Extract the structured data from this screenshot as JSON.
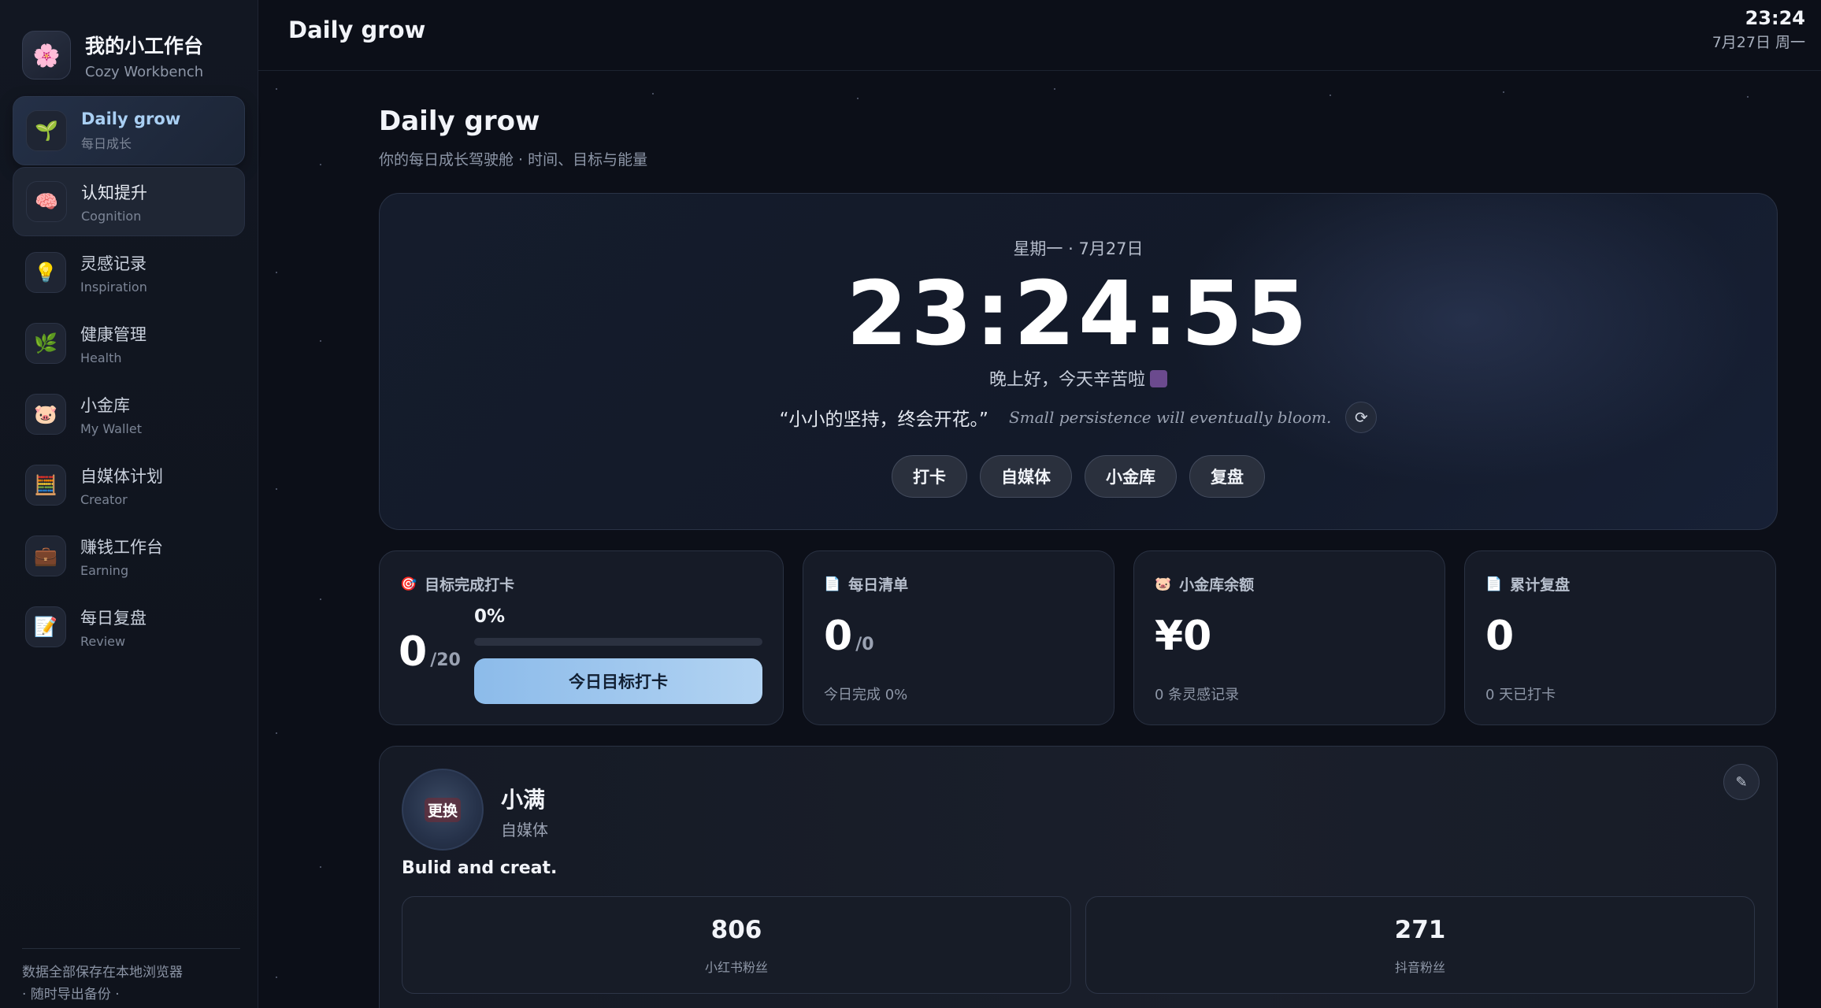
{
  "sidebar": {
    "brand_title": "我的小工作台",
    "brand_sub": "Cozy Workbench",
    "brand_icon": "flower-icon",
    "items": [
      {
        "label": "Daily grow",
        "sub": "每日成长",
        "icon": "seedling-icon",
        "glyph": "🌱"
      },
      {
        "label": "认知提升",
        "sub": "Cognition",
        "icon": "brain-icon",
        "glyph": "🧠"
      },
      {
        "label": "灵感记录",
        "sub": "Inspiration",
        "icon": "lightbulb-icon",
        "glyph": "💡"
      },
      {
        "label": "健康管理",
        "sub": "Health",
        "icon": "herb-icon",
        "glyph": "🌿"
      },
      {
        "label": "小金库",
        "sub": "My Wallet",
        "icon": "piggy-bank-icon",
        "glyph": "🐷"
      },
      {
        "label": "自媒体计划",
        "sub": "Creator",
        "icon": "calculator-icon",
        "glyph": "🧮"
      },
      {
        "label": "赚钱工作台",
        "sub": "Earning",
        "icon": "briefcase-icon",
        "glyph": "💼"
      },
      {
        "label": "每日复盘",
        "sub": "Review",
        "icon": "memo-icon",
        "glyph": "📝"
      }
    ],
    "footer_line1": "数据全部保存在本地浏览器",
    "footer_line2": "· 随时导出备份 ·"
  },
  "topbar": {
    "title": "Daily grow",
    "time": "23:24",
    "date": "7月27日 周一"
  },
  "page": {
    "title": "Daily grow",
    "subtitle": "你的每日成长驾驶舱 · 时间、目标与能量"
  },
  "hero": {
    "date": "星期一 · 7月27日",
    "time": "23:24:55",
    "greeting": "晚上好，今天辛苦啦",
    "quote_cn": "“小小的坚持，终会开花。”",
    "quote_en": "Small persistence will eventually bloom.",
    "actions": [
      "打卡",
      "自媒体",
      "小金库",
      "复盘"
    ]
  },
  "stats": {
    "goal": {
      "title": "目标完成打卡",
      "icon": "target-icon",
      "done": "0",
      "total": "/20",
      "percent_label": "0%",
      "progress": 0,
      "button": "今日目标打卡"
    },
    "list": {
      "title": "每日清单",
      "icon": "memo-icon",
      "value": "0",
      "unit": "/0",
      "foot": "今日完成 0%"
    },
    "wallet": {
      "title": "小金库余额",
      "icon": "piggy-bank-icon",
      "value": "¥0",
      "foot": "0 条灵感记录"
    },
    "review": {
      "title": "累计复盘",
      "icon": "memo-icon",
      "value": "0",
      "foot": "0 天已打卡"
    }
  },
  "profile": {
    "avatar_button": "更换",
    "name": "小满",
    "role": "自媒体",
    "bio": "Bulid and creat.",
    "fans": [
      {
        "value": "806",
        "label": "小红书粉丝"
      },
      {
        "value": "271",
        "label": "抖音粉丝"
      }
    ]
  }
}
